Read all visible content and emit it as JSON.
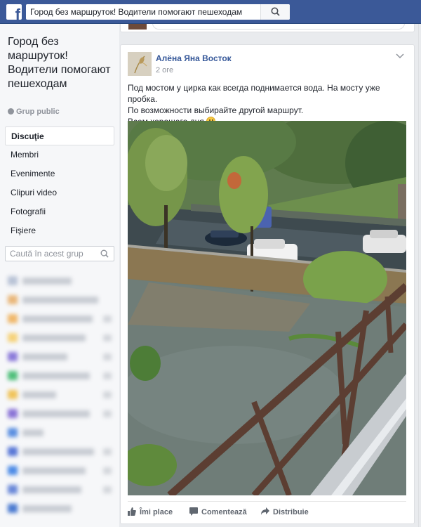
{
  "topbar": {
    "logo_letter": "f",
    "search_value": "Город без маршруток! Водители помогают пешеходам"
  },
  "group": {
    "title": "Город без маршруток! Водители помогают пешеходам",
    "privacy": "Grup public"
  },
  "nav": {
    "items": [
      {
        "label": "Discuţie",
        "active": true
      },
      {
        "label": "Membri"
      },
      {
        "label": "Evenimente"
      },
      {
        "label": "Clipuri video"
      },
      {
        "label": "Fotografii"
      },
      {
        "label": "Fişiere"
      }
    ]
  },
  "group_search": {
    "placeholder": "Caută în acest grup"
  },
  "post": {
    "author": "Алёна Яна Восток",
    "time": "2 ore",
    "text_lines": [
      "Под мостом у цирка как всегда поднимается вода. На мосту уже пробка.",
      "По возможности выбирайте другой маршрут.",
      "Всем хорошего дня"
    ],
    "emoji": "smile-emoji",
    "actions": {
      "like": "Îmi place",
      "comment": "Comentează",
      "share": "Distribuie"
    }
  },
  "colors": {
    "brand": "#3b5998",
    "link": "#365899",
    "background": "#e9ebee"
  }
}
